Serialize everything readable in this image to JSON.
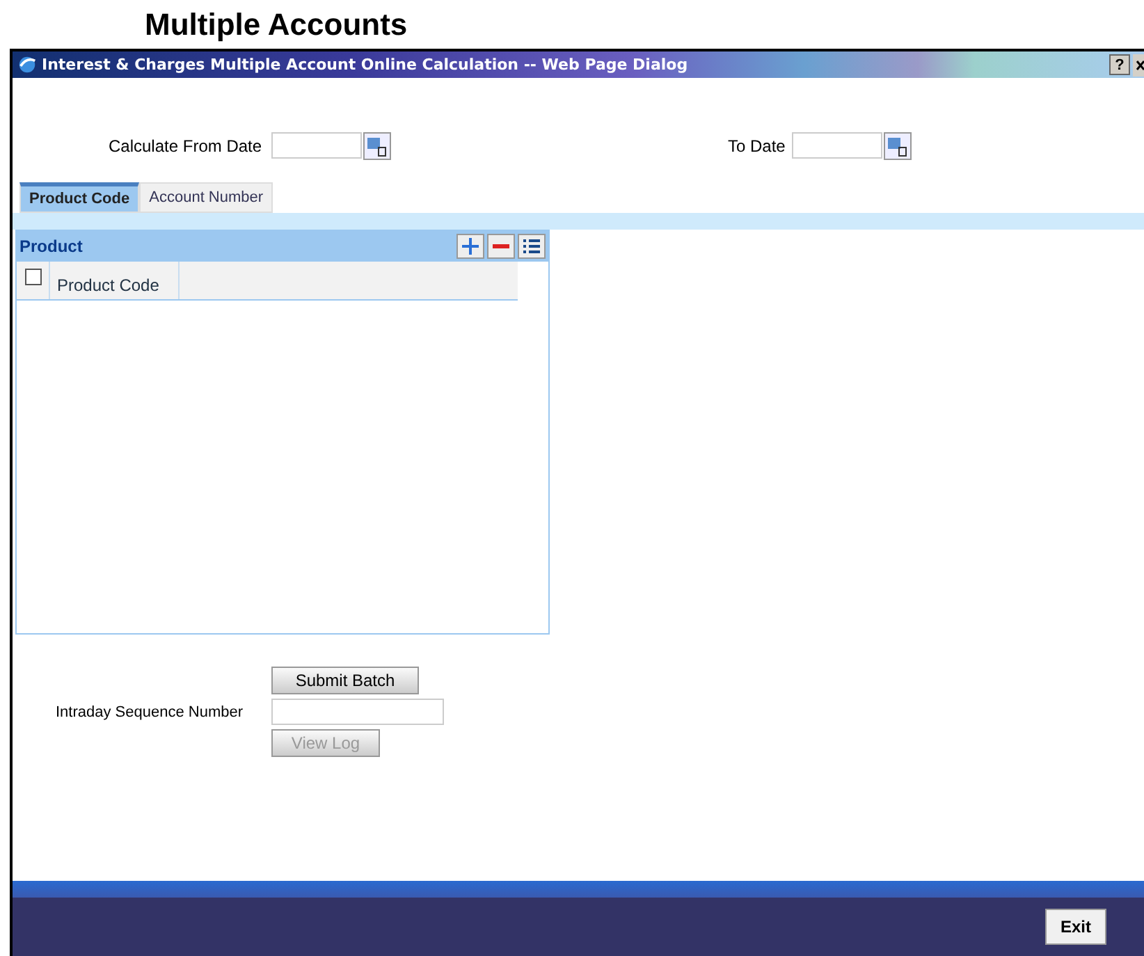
{
  "heading": "Multiple Accounts",
  "window": {
    "title": "Interest & Charges Multiple Account Online Calculation -- Web Page Dialog",
    "help": "?"
  },
  "dates": [
    {
      "label": "Calculate From Date"
    },
    {
      "label": "To Date"
    }
  ],
  "tabs": [
    {
      "label": "Product Code",
      "selected": true
    },
    {
      "label": "Account Number",
      "selected": false
    }
  ],
  "grid": {
    "title": "Product",
    "select_all_checked": false,
    "columns": [
      "Product Code"
    ]
  },
  "actions": {
    "submit": {
      "label": "Submit Batch",
      "disabled": false
    },
    "sequence_label": "Intraday Sequence Number",
    "view_log": {
      "label": "View Log",
      "disabled": true
    }
  },
  "footer": {
    "exit": "Exit"
  }
}
